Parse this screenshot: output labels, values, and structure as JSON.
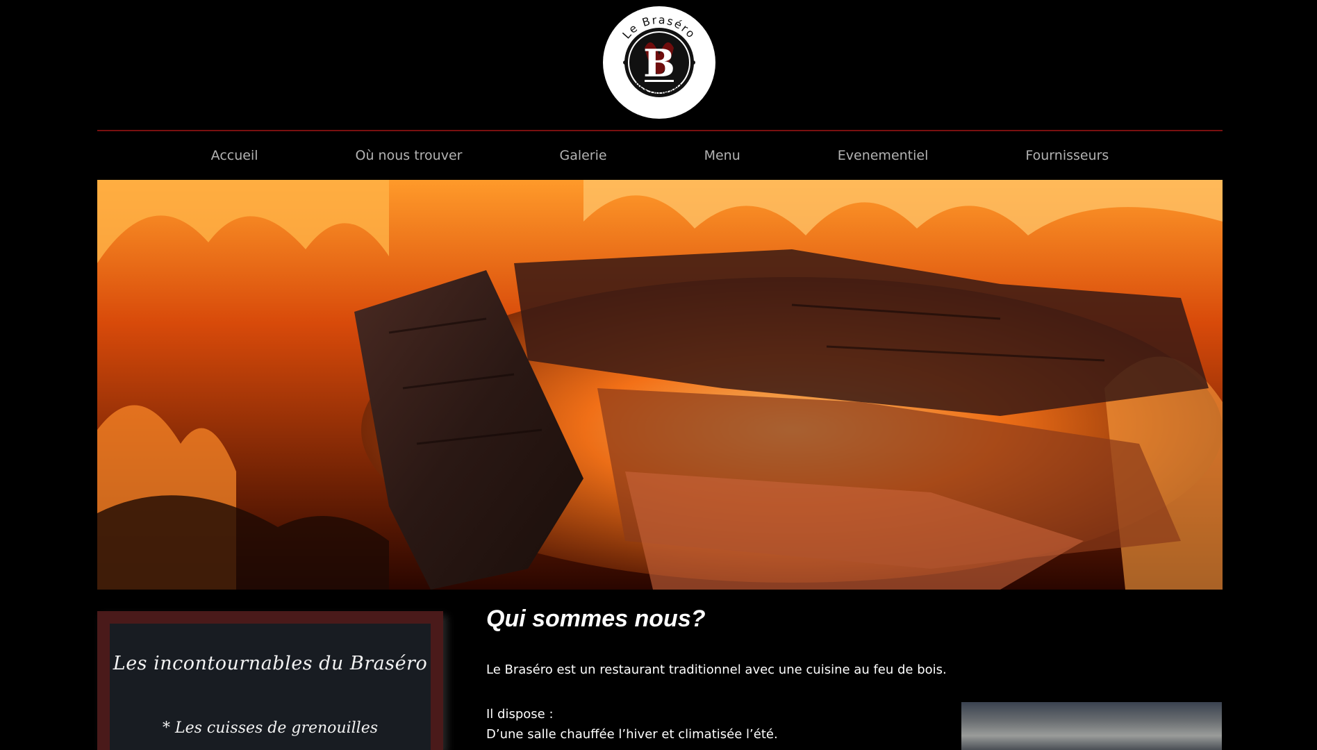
{
  "logo": {
    "top_text": "Le Braséro",
    "letter": "B",
    "bottom_text": "RESTAURANT"
  },
  "nav": {
    "items": [
      {
        "label": "Accueil"
      },
      {
        "label": "Où nous trouver"
      },
      {
        "label": "Galerie"
      },
      {
        "label": "Menu"
      },
      {
        "label": "Evenementiel"
      },
      {
        "label": "Fournisseurs"
      }
    ]
  },
  "sidebar": {
    "title": "Les incontournables du Braséro",
    "items": [
      {
        "label": "* Les cuisses de grenouilles"
      }
    ]
  },
  "main": {
    "heading": "Qui sommes nous?",
    "intro": "Le Braséro est un restaurant traditionnel avec une cuisine au feu de bois.",
    "dispose_label": "Il dispose :",
    "line1": "D’une salle chauffée l’hiver et climatisée l’été."
  },
  "colors": {
    "background": "#000000",
    "nav_text": "#b3b3b3",
    "rule": "#7a1010",
    "board_frame": "#4a1a1a",
    "board_inner": "#181c22"
  }
}
